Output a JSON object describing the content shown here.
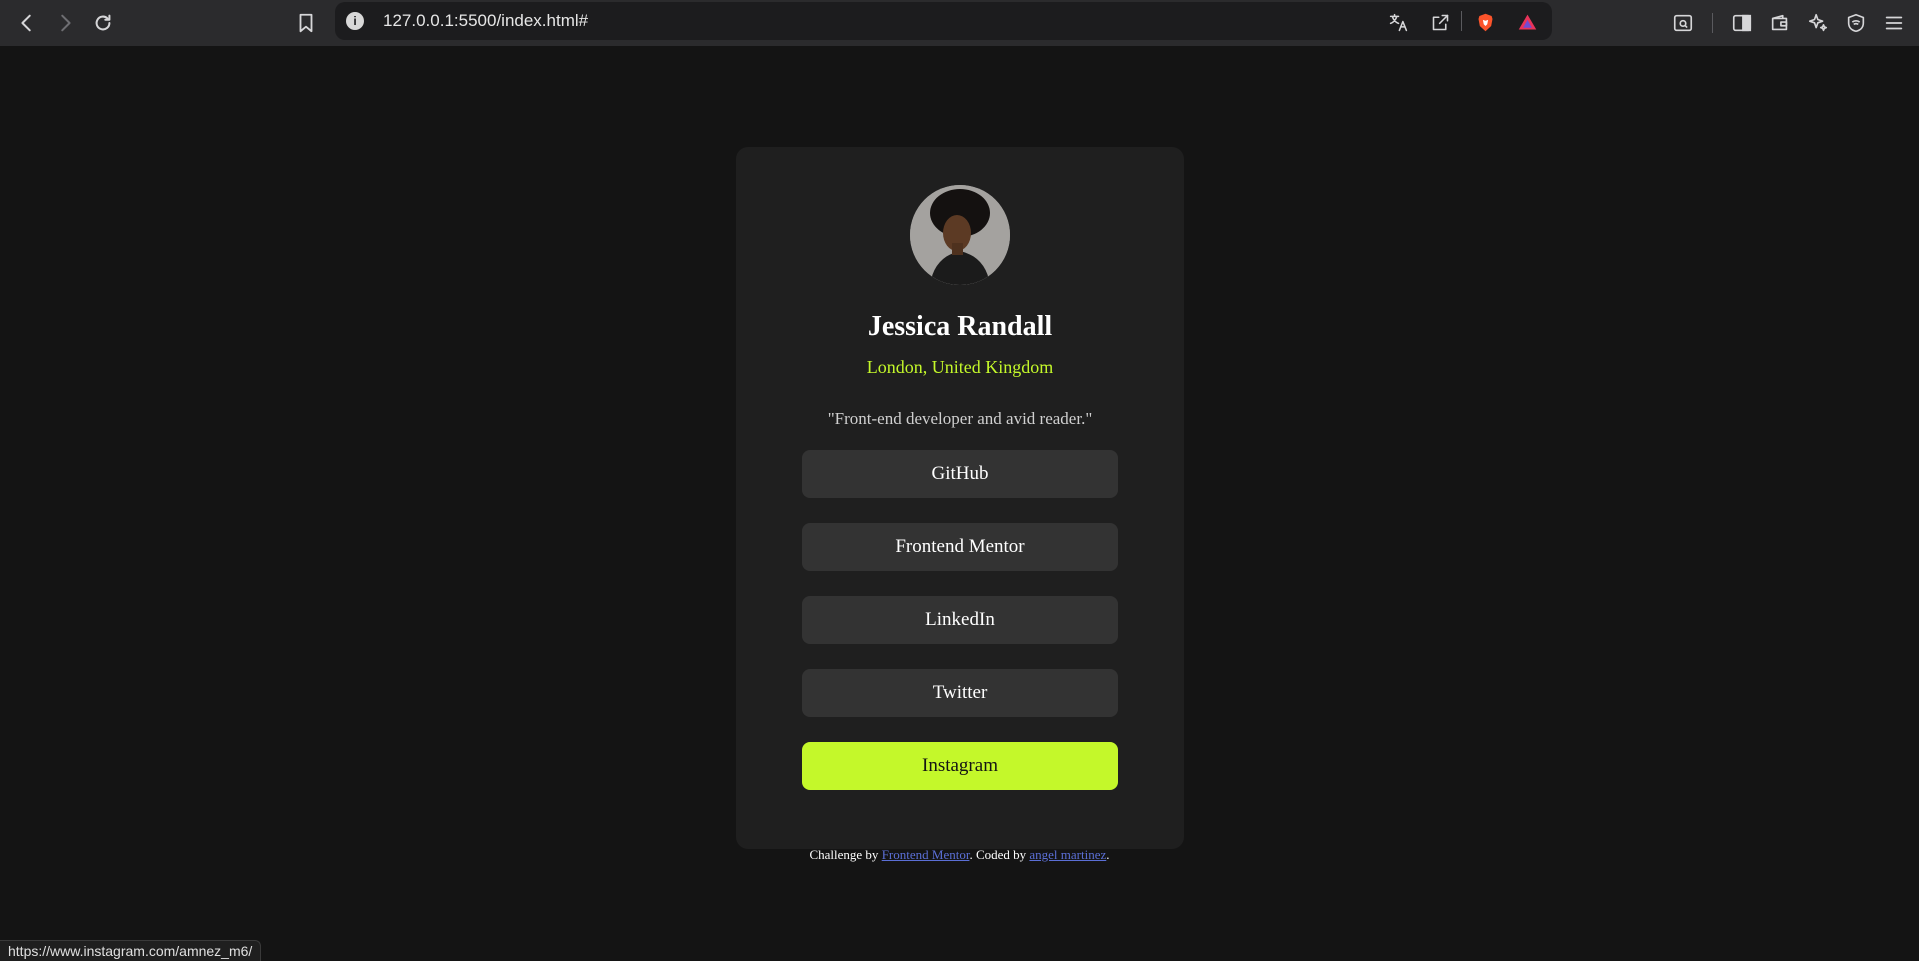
{
  "browser": {
    "url": "127.0.0.1:5500/index.html#",
    "icons": [
      "back-icon",
      "forward-icon",
      "reload-icon",
      "bookmark-icon",
      "info-icon",
      "translate-icon",
      "share-icon",
      "brave-shield-icon",
      "brave-rewards-icon",
      "reader-mode-icon",
      "sidebar-icon",
      "wallet-icon",
      "leo-ai-icon",
      "vpn-icon",
      "menu-icon"
    ]
  },
  "profile": {
    "name": "Jessica Randall",
    "location": "London, United Kingdom",
    "bio": "\"Front-end developer and avid reader.\""
  },
  "links": [
    {
      "label": "GitHub",
      "active": false
    },
    {
      "label": "Frontend Mentor",
      "active": false
    },
    {
      "label": "LinkedIn",
      "active": false
    },
    {
      "label": "Twitter",
      "active": false
    },
    {
      "label": "Instagram",
      "active": true
    }
  ],
  "attribution": {
    "prefix": "Challenge by ",
    "link1": "Frontend Mentor",
    "middle": ". Coded by ",
    "link2": "angel martinez",
    "suffix": "."
  },
  "status_url": "https://www.instagram.com/amnez_m6/",
  "colors": {
    "accent": "#c4f82a",
    "background": "#141414",
    "card": "#1f1f1f",
    "button": "#333333"
  }
}
